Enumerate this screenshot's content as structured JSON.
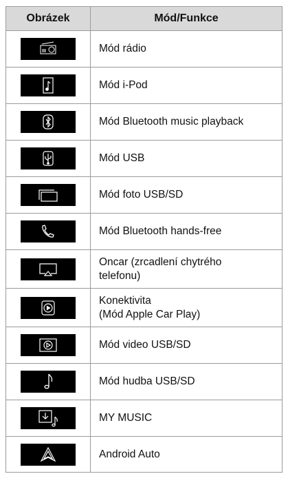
{
  "table": {
    "headers": {
      "col1": "Obrázek",
      "col2": "Mód/Funkce"
    },
    "rows": [
      {
        "icon": "radio-icon",
        "label": "Mód rádio"
      },
      {
        "icon": "ipod-icon",
        "label": "Mód i-Pod"
      },
      {
        "icon": "bluetooth-icon",
        "label": "Mód Bluetooth music playback"
      },
      {
        "icon": "usb-icon",
        "label": "Mód USB"
      },
      {
        "icon": "photo-icon",
        "label": "Mód foto USB/SD"
      },
      {
        "icon": "phone-icon",
        "label": "Mód Bluetooth hands-free"
      },
      {
        "icon": "screen-mirror-icon",
        "label_line1": "Oncar (zrcadlení chytrého",
        "label_line2": "telefonu)"
      },
      {
        "icon": "apple-carplay-icon",
        "label_line1": "Konektivita",
        "label_line2": "(Mód Apple Car Play)"
      },
      {
        "icon": "video-icon",
        "label": "Mód video USB/SD"
      },
      {
        "icon": "music-note-icon",
        "label": "Mód hudba USB/SD"
      },
      {
        "icon": "my-music-icon",
        "label": "MY MUSIC"
      },
      {
        "icon": "android-auto-icon",
        "label": "Android Auto"
      }
    ]
  }
}
